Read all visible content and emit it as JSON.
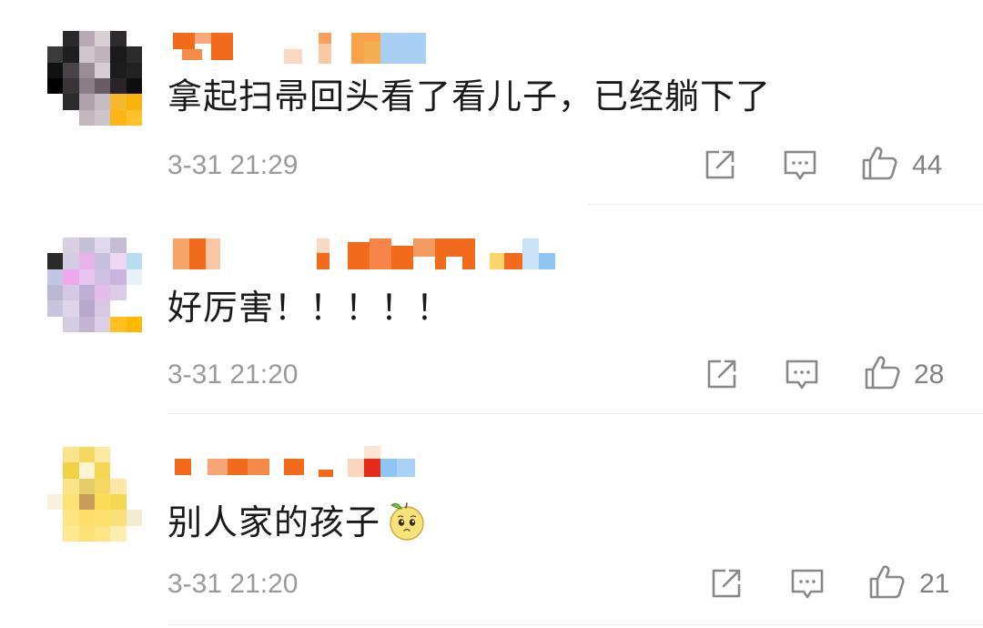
{
  "comments": [
    {
      "text": "拿起扫帚回头看了看儿子，已经躺下了",
      "timestamp": "3-31 21:29",
      "likes": "44",
      "actions": {
        "share_icon": "share-icon",
        "reply_icon": "comment-icon",
        "like_icon": "thumbs-up-icon"
      }
    },
    {
      "text": "好厉害！！！！！",
      "timestamp": "3-31 21:20",
      "likes": "28",
      "actions": {
        "share_icon": "share-icon",
        "reply_icon": "comment-icon",
        "like_icon": "thumbs-up-icon"
      }
    },
    {
      "text": "别人家的孩子",
      "emoji": "pleading-face-emoji",
      "timestamp": "3-31 21:20",
      "likes": "21",
      "actions": {
        "share_icon": "share-icon",
        "reply_icon": "comment-icon",
        "like_icon": "thumbs-up-icon"
      }
    }
  ],
  "colors": {
    "text": "#1a1a1a",
    "meta": "#9a9a9a",
    "icon": "#888888",
    "divider": "#ececec",
    "username_accent": "#f26b1d",
    "username_blue": "#8ec5f5"
  }
}
